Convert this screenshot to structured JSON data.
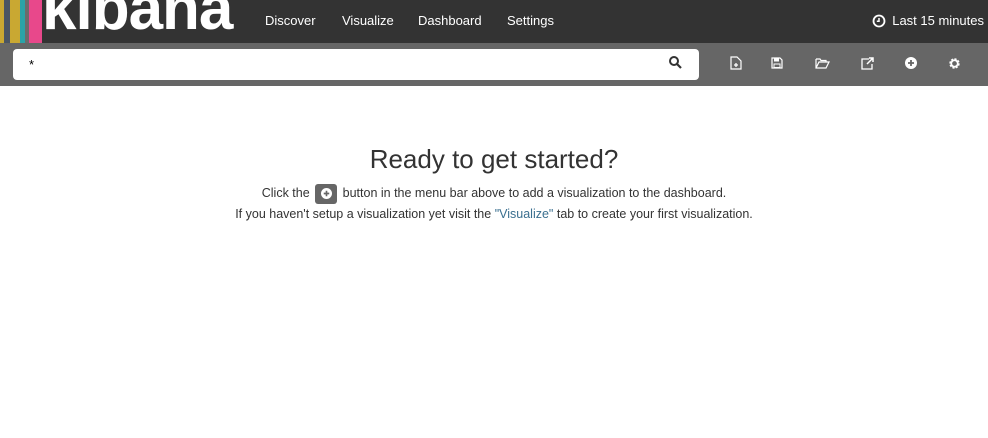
{
  "brand": {
    "logo_text": "kibana",
    "stripe_colors": [
      "#c9a832",
      "#4a5563",
      "#c9a832",
      "#2aa3a8",
      "#6b6b6b",
      "#e8488b"
    ]
  },
  "nav": {
    "items": [
      {
        "label": "Discover"
      },
      {
        "label": "Visualize"
      },
      {
        "label": "Dashboard"
      },
      {
        "label": "Settings"
      }
    ],
    "active": "Dashboard"
  },
  "timepicker": {
    "label": "Last 15 minutes",
    "icon": "clock-icon"
  },
  "search": {
    "value": "*",
    "icon": "search-icon"
  },
  "toolbar": {
    "icons": [
      "new-dashboard-icon",
      "save-icon",
      "open-folder-icon",
      "share-icon",
      "add-visualization-icon",
      "settings-gear-icon"
    ]
  },
  "main": {
    "title": "Ready to get started?",
    "line1_before": "Click the",
    "line1_after": "button in the menu bar above to add a visualization to the dashboard.",
    "line2_before": "If you haven't setup a visualization yet visit the",
    "line2_link": "\"Visualize\"",
    "line2_after": "tab to create your first visualization."
  }
}
